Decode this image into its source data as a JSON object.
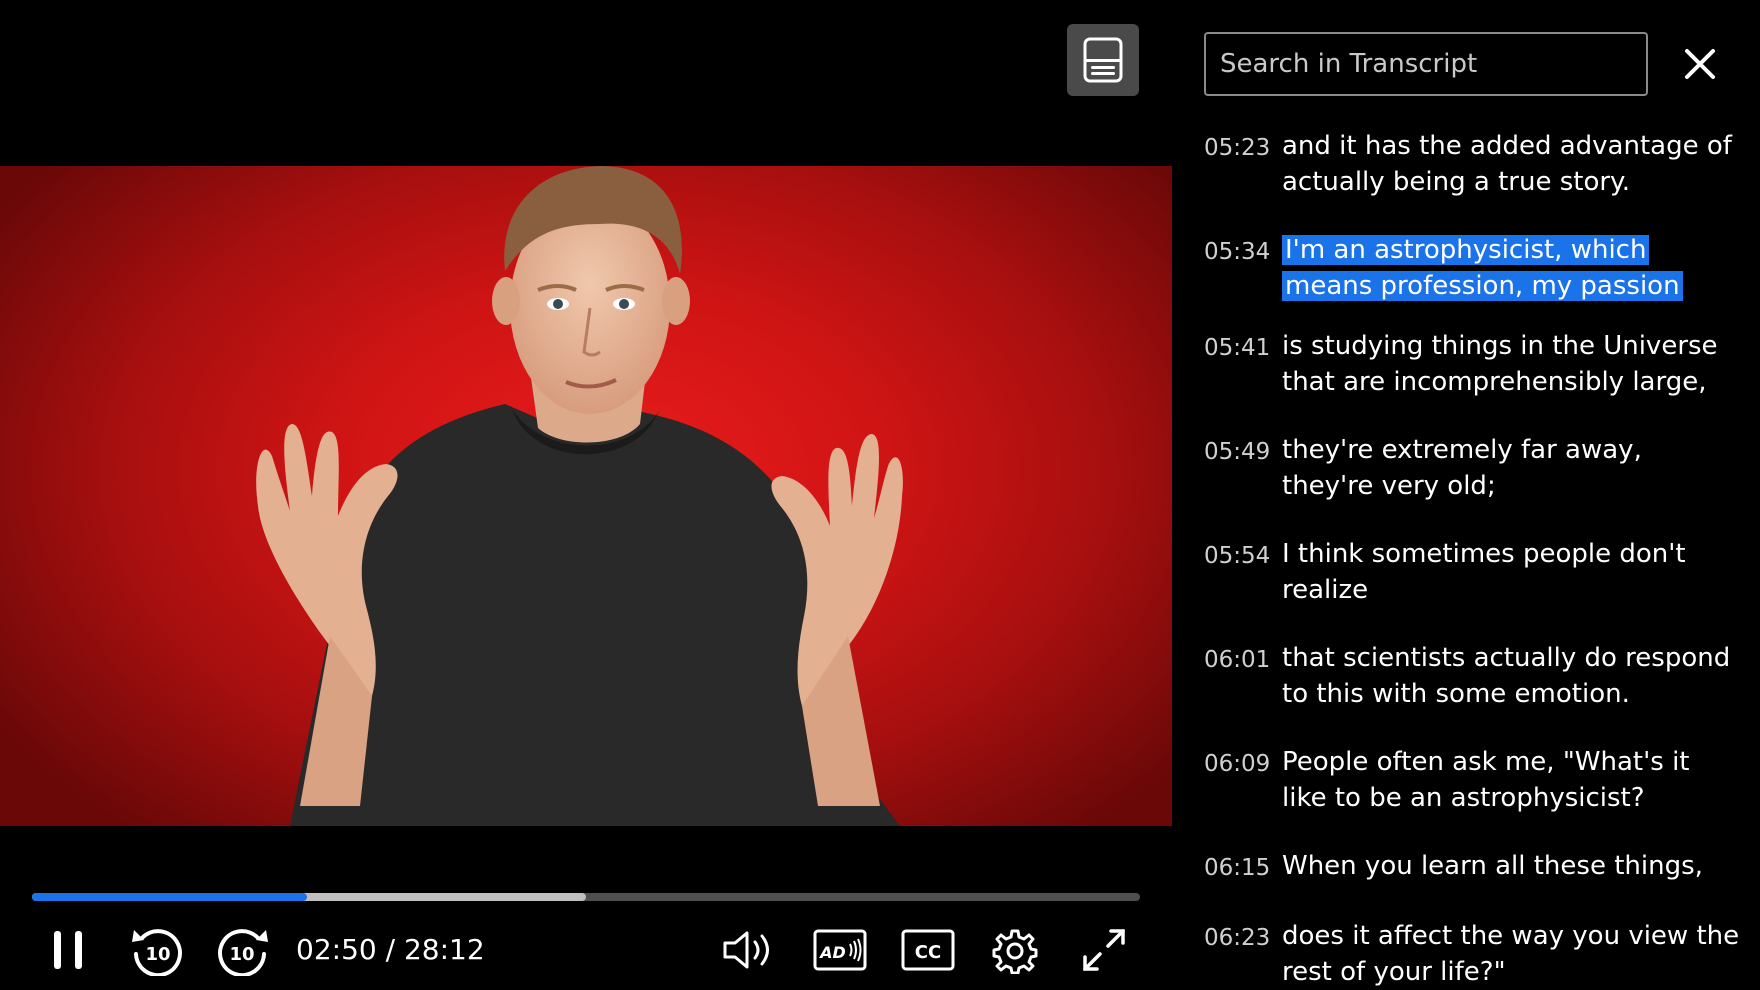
{
  "player": {
    "transcript_toggle_label": "Transcript",
    "current_time": "02:50",
    "duration": "28:12",
    "time_separator": " / ",
    "played_fraction": 0.248,
    "buffered_fraction": 0.5,
    "rewind_seconds": "10",
    "forward_seconds": "10",
    "ad_label": "AD",
    "cc_label": "CC",
    "icons": {
      "transcript": "transcript-icon",
      "pause": "pause-icon",
      "rewind": "rewind-10-icon",
      "forward": "forward-10-icon",
      "volume": "volume-icon",
      "audio_description": "audio-description-icon",
      "captions": "closed-captions-icon",
      "settings": "gear-icon",
      "fullscreen": "fullscreen-icon"
    },
    "colors": {
      "progress_played": "#1a73e8",
      "progress_buffered": "#bfbfbf",
      "progress_track": "#4f4f4f",
      "video_bg": "#d41515"
    }
  },
  "transcript": {
    "search_placeholder": "Search in Transcript",
    "close_icon": "close-icon",
    "highlight_color": "#1a73e8",
    "cues": [
      {
        "time": "05:23",
        "text": "and it has the added advantage of actually being a true story.",
        "active": false
      },
      {
        "time": "05:34",
        "text": "I'm an astrophysicist, which means profession, my passion",
        "active": true
      },
      {
        "time": "05:41",
        "text": "is studying things in the Universe that are incomprehensibly large,",
        "active": false
      },
      {
        "time": "05:49",
        "text": "they're extremely far away, they're very old;",
        "active": false
      },
      {
        "time": "05:54",
        "text": "I think sometimes people don't realize",
        "active": false
      },
      {
        "time": "06:01",
        "text": "that scientists actually do respond to this with some emotion.",
        "active": false
      },
      {
        "time": "06:09",
        "text": "People often ask me, \"What's it like to be an astrophysicist?",
        "active": false
      },
      {
        "time": "06:15",
        "text": "When you learn all these things,",
        "active": false
      },
      {
        "time": "06:23",
        "text": "does it affect the way you view the rest of your life?\"",
        "active": false
      }
    ]
  }
}
